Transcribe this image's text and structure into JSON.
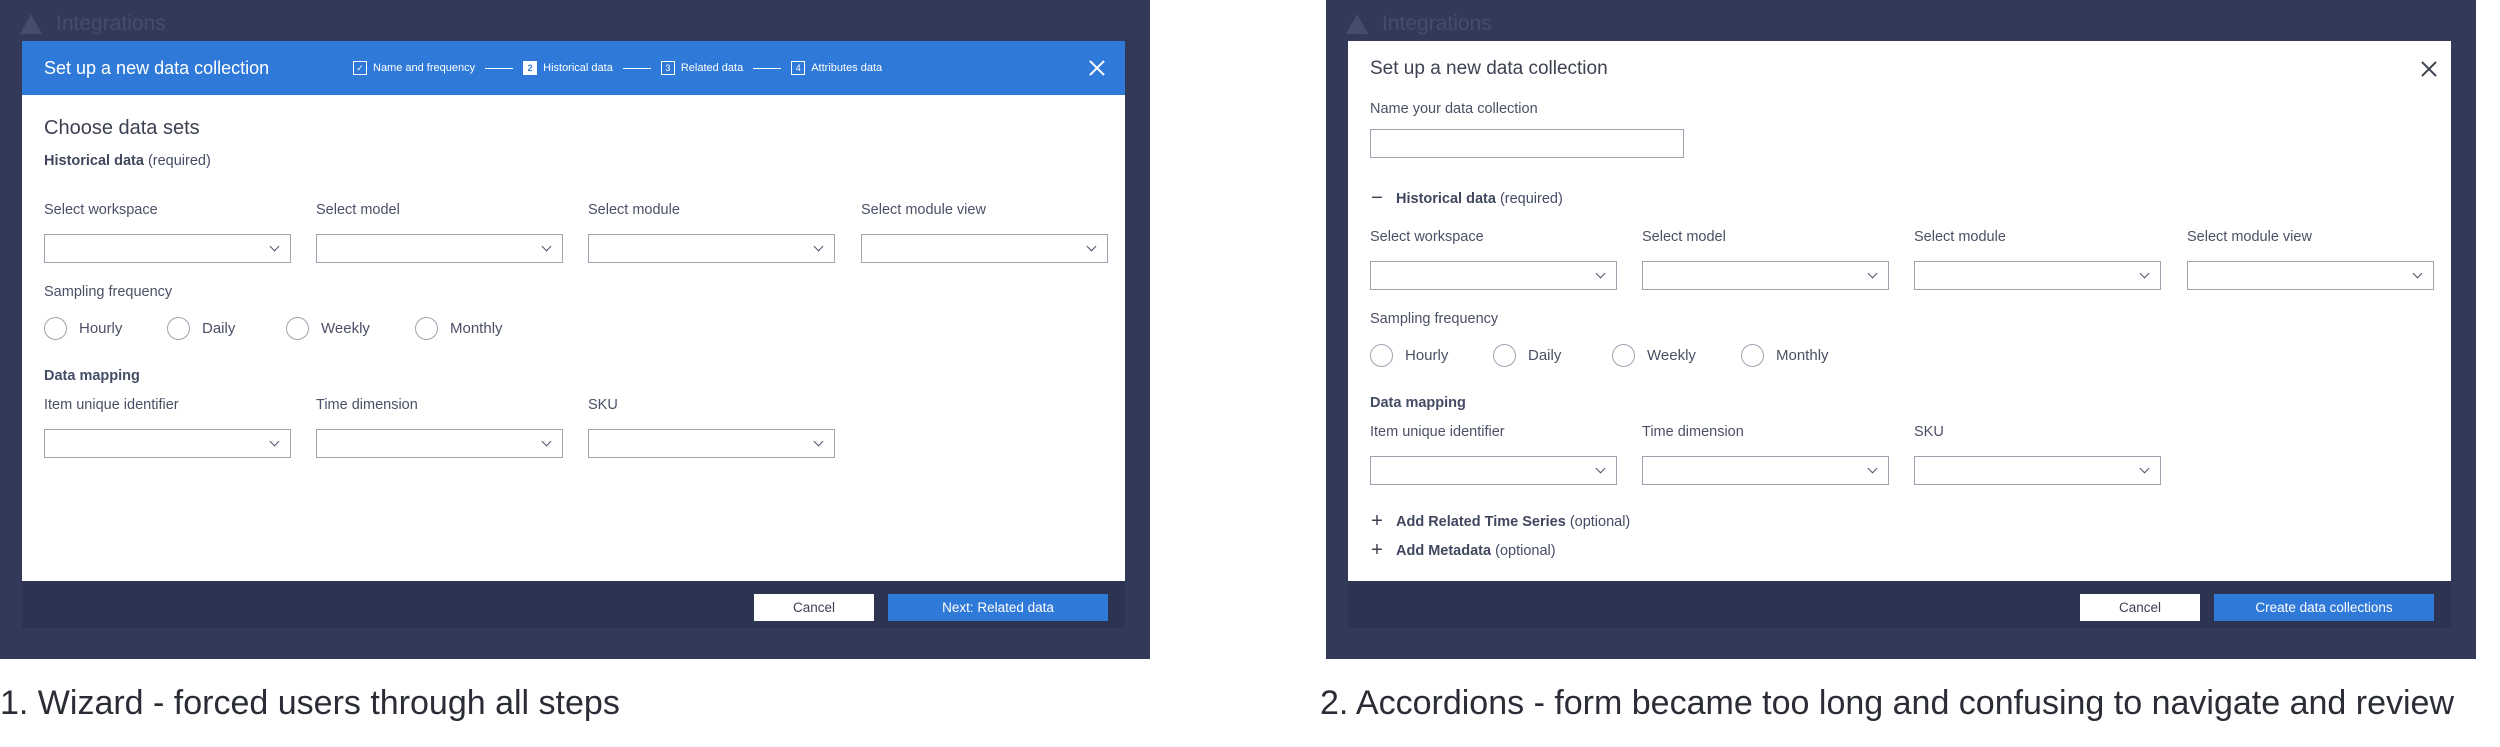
{
  "background_app_title": "Integrations",
  "wizard": {
    "title": "Set up a new data collection",
    "steps": [
      {
        "marker": "✓",
        "label": "Name and frequency"
      },
      {
        "marker": "2",
        "label": "Historical data"
      },
      {
        "marker": "3",
        "label": "Related data"
      },
      {
        "marker": "4",
        "label": "Attributes data"
      }
    ],
    "heading": "Choose data sets",
    "historical": {
      "label": "Historical data",
      "note": "(required)"
    },
    "selects": [
      "Select workspace",
      "Select model",
      "Select module",
      "Select module view"
    ],
    "sampling_label": "Sampling frequency",
    "radios": [
      "Hourly",
      "Daily",
      "Weekly",
      "Monthly"
    ],
    "mapping_label": "Data mapping",
    "mapping_fields": [
      "Item unique identifier",
      "Time dimension",
      "SKU"
    ],
    "cancel": "Cancel",
    "next": "Next: Related data"
  },
  "accordion": {
    "title": "Set up a new data collection",
    "name_label": "Name your data collection",
    "name_value": "",
    "historical": {
      "toggle": "−",
      "label": "Historical data",
      "note": "(required)"
    },
    "selects": [
      "Select workspace",
      "Select model",
      "Select module",
      "Select module view"
    ],
    "sampling_label": "Sampling frequency",
    "radios": [
      "Hourly",
      "Daily",
      "Weekly",
      "Monthly"
    ],
    "mapping_label": "Data mapping",
    "mapping_fields": [
      "Item unique identifier",
      "Time dimension",
      "SKU"
    ],
    "related": {
      "toggle": "+",
      "label": "Add Related Time Series",
      "note": "(optional)"
    },
    "metadata": {
      "toggle": "+",
      "label": "Add Metadata",
      "note": "(optional)"
    },
    "cancel": "Cancel",
    "create": "Create data collections"
  },
  "captions": [
    "1. Wizard - forced users through all steps",
    "2. Accordions - form became too long and confusing to navigate and review"
  ],
  "colors": {
    "overlay": "#333a59",
    "accent": "#2f79d8",
    "footer": "#2d3452"
  }
}
